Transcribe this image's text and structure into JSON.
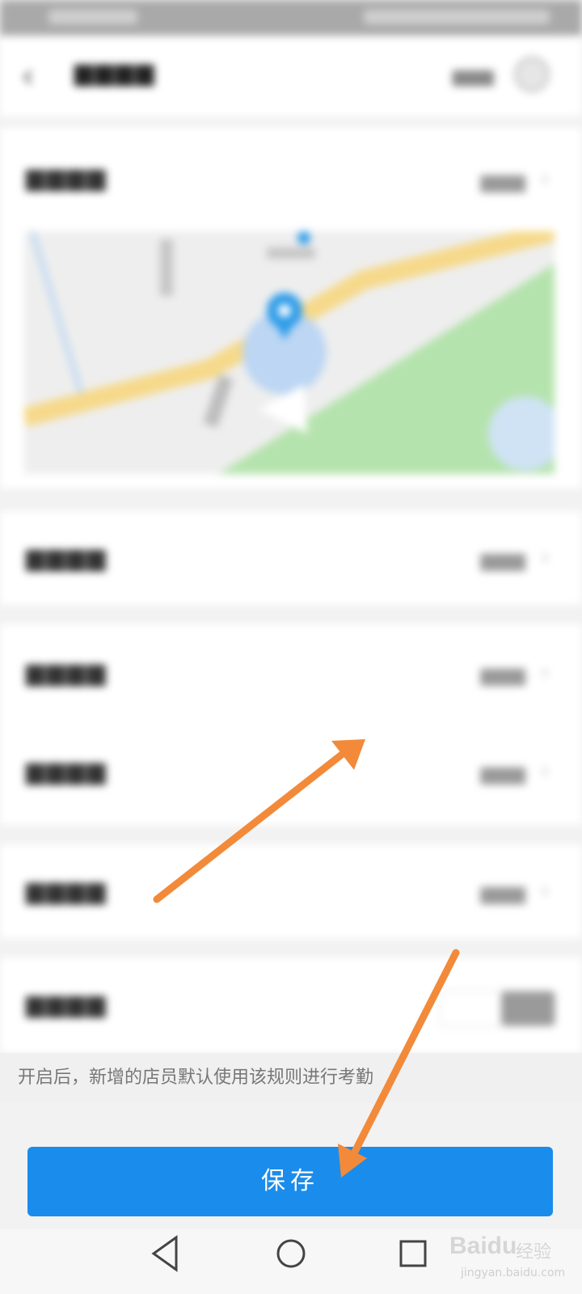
{
  "hint": {
    "text": "开启后，新增的店员默认使用该规则进行考勤"
  },
  "footer": {
    "save_label": "保存"
  },
  "watermark": {
    "brand": "Baidu",
    "suffix": "经验",
    "url": "jingyan.baidu.com"
  },
  "icons": {
    "back": "back-arrow-icon",
    "chevron": "chevron-right-icon",
    "nav_back": "triangle-back-icon",
    "nav_home": "circle-home-icon",
    "nav_recent": "square-recents-icon",
    "map_pin": "location-pin-icon"
  },
  "colors": {
    "primary": "#1a8ceb",
    "arrow": "#f28a3a",
    "map_green": "#b5e3ad",
    "map_road": "#f6d98a",
    "map_pin": "#2b9be8"
  }
}
